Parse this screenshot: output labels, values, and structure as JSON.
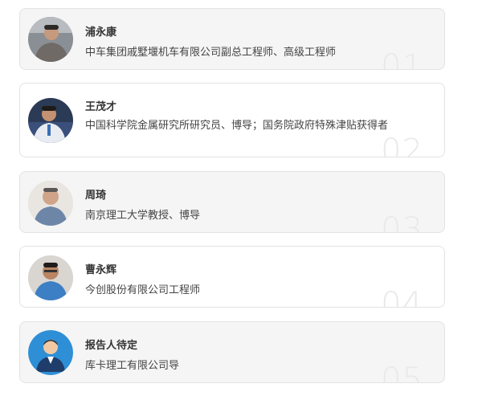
{
  "speakers": [
    {
      "name": "浦永康",
      "title": "中车集团戚墅堰机车有限公司副总工程师、高级工程师",
      "index": "01"
    },
    {
      "name": "王茂才",
      "title": "中国科学院金属研究所研究员、博导；国务院政府特殊津贴获得者",
      "index": "02"
    },
    {
      "name": "周琦",
      "title": "南京理工大学教授、博导",
      "index": "03"
    },
    {
      "name": "曹永辉",
      "title": "今创股份有限公司工程师",
      "index": "04"
    },
    {
      "name": "报告人待定",
      "title": "库卡理工有限公司导",
      "index": "05"
    }
  ],
  "icons": [
    "avatar-photo",
    "avatar-photo",
    "avatar-photo",
    "avatar-photo",
    "avatar-placeholder-icon"
  ],
  "colors": {
    "card_alt": "#f5f5f5",
    "card_plain": "#ffffff",
    "border": "#e3e3e3",
    "index_number": "#e9e9e9",
    "placeholder_bg": "#2e8fd6"
  }
}
